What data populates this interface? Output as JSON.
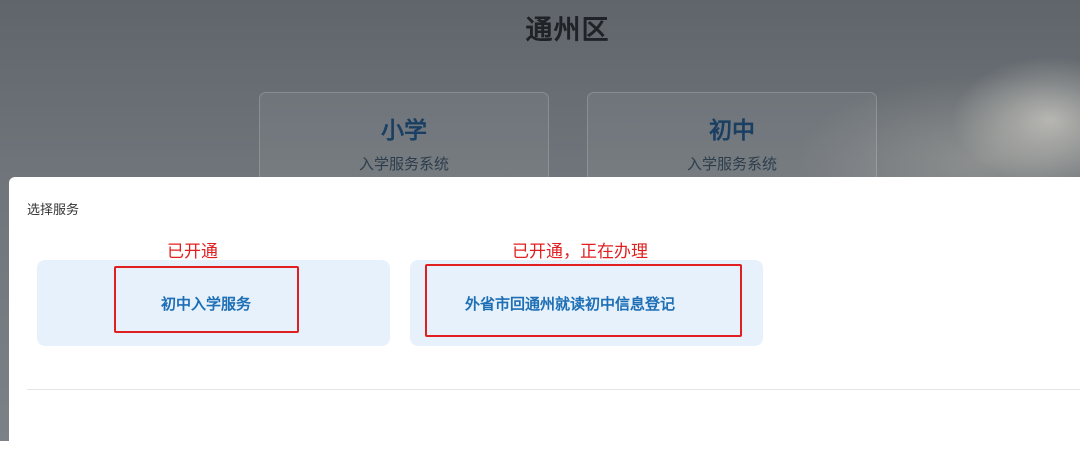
{
  "header": {
    "title": "通州区"
  },
  "systems": [
    {
      "name": "小学",
      "subtitle": "入学服务系统"
    },
    {
      "name": "初中",
      "subtitle": "入学服务系统"
    }
  ],
  "dialog": {
    "title": "选择服务",
    "services": [
      {
        "label": "初中入学服务",
        "status": "已开通"
      },
      {
        "label": "外省市回通州就读初中信息登记",
        "status": "已开通，正在办理"
      }
    ]
  },
  "colors": {
    "annotation": "#e02020",
    "service_bg": "#e6f1fb",
    "service_text": "#1e6fb5"
  }
}
